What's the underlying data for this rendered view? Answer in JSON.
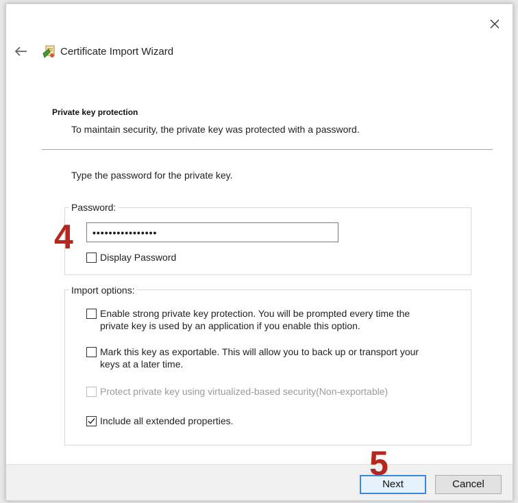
{
  "window": {
    "title": "Certificate Import Wizard",
    "close_icon": "close-icon",
    "back_icon": "back-arrow-icon",
    "wizard_icon": "certificate-wizard-icon"
  },
  "section": {
    "heading": "Private key protection",
    "description": "To maintain security, the private key was protected with a password."
  },
  "prompt": "Type the password for the private key.",
  "password_group": {
    "label": "Password:",
    "value": "••••••••••••••••",
    "display_password_label": "Display Password",
    "display_password_checked": false
  },
  "import_options": {
    "label": "Import options:",
    "options": [
      {
        "line1": "Enable strong private key protection. You will be prompted every time the",
        "line2": "private key is used by an application if you enable this option.",
        "checked": false,
        "enabled": true
      },
      {
        "line1": "Mark this key as exportable. This will allow you to back up or transport your",
        "line2": "keys at a later time.",
        "checked": false,
        "enabled": true
      },
      {
        "line1": "Protect private key using virtualized-based security(Non-exportable)",
        "line2": "",
        "checked": false,
        "enabled": false
      },
      {
        "line1": "Include all extended properties.",
        "line2": "",
        "checked": true,
        "enabled": true
      }
    ]
  },
  "annotations": {
    "step4": "4",
    "step5": "5",
    "color": "#b5261c"
  },
  "buttons": {
    "next": "Next",
    "cancel": "Cancel"
  }
}
